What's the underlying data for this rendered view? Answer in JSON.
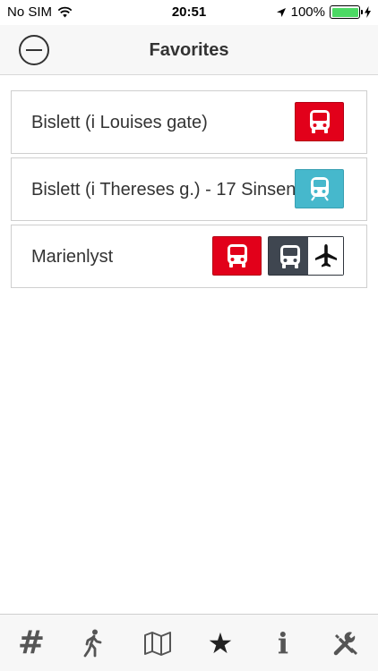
{
  "status_bar": {
    "carrier": "No SIM",
    "time": "20:51",
    "battery": "100%",
    "battery_level": 1.0
  },
  "nav": {
    "title": "Favorites"
  },
  "favorites": [
    {
      "name": "Bislett (i Louises gate)",
      "badges": [
        "bus-red"
      ]
    },
    {
      "name": "Bislett (i Thereses g.) - 17 Sinsen",
      "badges": [
        "tram-teal"
      ]
    },
    {
      "name": "Marienlyst",
      "badges": [
        "bus-red",
        "airport-bus"
      ]
    }
  ],
  "tab_bar": {
    "tabs": [
      {
        "icon": "hash-icon",
        "glyph": "#"
      },
      {
        "icon": "walking-icon"
      },
      {
        "icon": "map-icon"
      },
      {
        "icon": "star-icon",
        "glyph": "★",
        "selected": true
      },
      {
        "icon": "info-icon",
        "glyph": "i"
      },
      {
        "icon": "tools-icon"
      }
    ]
  },
  "colors": {
    "bus_red": "#e2001a",
    "tram_teal": "#46b8cc",
    "airport_dark": "#3f4650",
    "battery_green": "#4cd964"
  }
}
